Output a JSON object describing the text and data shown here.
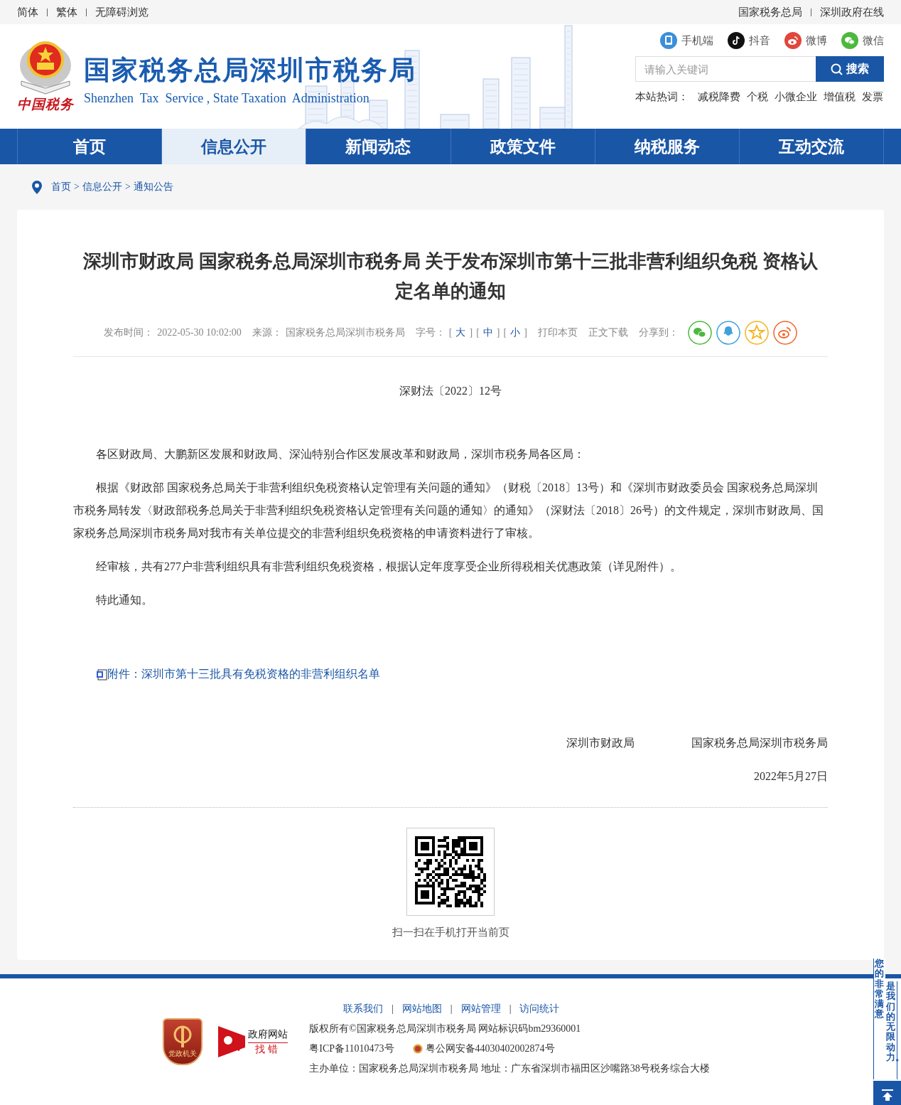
{
  "top_bar": {
    "left_links": [
      "简体",
      "繁体",
      "无障碍浏览"
    ],
    "right_links": [
      "国家税务总局",
      "深圳政府在线"
    ]
  },
  "header": {
    "emblem_caption": "中国税务",
    "site_name": "国家税务总局深圳市税务局",
    "site_name_en": "Shenzhen  Tax  Service , State Taxation  Administration",
    "social": [
      {
        "kind": "mobile",
        "label": "手机端"
      },
      {
        "kind": "douyin",
        "label": "抖音"
      },
      {
        "kind": "weibo",
        "label": "微博"
      },
      {
        "kind": "wechat",
        "label": "微信"
      }
    ],
    "search": {
      "placeholder": "请输入关键词",
      "button": "搜索"
    },
    "hot_words": {
      "label": "本站热词：",
      "words": [
        "减税降费",
        "个税",
        "小微企业",
        "增值税",
        "发票"
      ]
    }
  },
  "nav": [
    {
      "label": "首页",
      "selected": false
    },
    {
      "label": "信息公开",
      "selected": true
    },
    {
      "label": "新闻动态",
      "selected": false
    },
    {
      "label": "政策文件",
      "selected": false
    },
    {
      "label": "纳税服务",
      "selected": false
    },
    {
      "label": "互动交流",
      "selected": false
    }
  ],
  "breadcrumb": {
    "items": [
      "首页",
      "信息公开",
      "通知公告"
    ],
    "separators": [
      ">",
      ">"
    ]
  },
  "article": {
    "title": "深圳市财政局 国家税务总局深圳市税务局 关于发布深圳市第十三批非营利组织免税 资格认定名单的通知",
    "meta": {
      "published_label": "发布时间：",
      "published": "2022-05-30 10:02:00",
      "source_label": "来源：",
      "source": "国家税务总局深圳市税务局",
      "font_size_label": "字号：",
      "font_sizes": [
        {
          "open": "[",
          "label": "大",
          "close": "]"
        },
        {
          "open": "[",
          "label": "中",
          "close": "]"
        },
        {
          "open": "[",
          "label": "小",
          "close": "]"
        }
      ],
      "print": "打印本页",
      "download": "正文下载",
      "share_label": "分享到："
    },
    "share": [
      {
        "kind": "wechat"
      },
      {
        "kind": "qq"
      },
      {
        "kind": "qzone"
      },
      {
        "kind": "weibo"
      }
    ],
    "doc_number": "深财法〔2022〕12号",
    "paragraphs": [
      "各区财政局、大鹏新区发展和财政局、深汕特别合作区发展改革和财政局，深圳市税务局各区局：",
      "根据《财政部 国家税务总局关于非营利组织免税资格认定管理有关问题的通知》（财税〔2018〕13号）和《深圳市财政委员会 国家税务总局深圳市税务局转发〈财政部税务总局关于非营利组织免税资格认定管理有关问题的通知〉的通知》（深财法〔2018〕26号）的文件规定，深圳市财政局、国家税务总局深圳市税务局对我市有关单位提交的非营利组织免税资格的申请资料进行了审核。",
      "经审核，共有277户非营利组织具有非营利组织免税资格，根据认定年度享受企业所得税相关优惠政策（详见附件）。",
      "特此通知。"
    ],
    "attachment": "附件：深圳市第十三批具有免税资格的非营利组织名单",
    "signatures": [
      "深圳市财政局",
      "国家税务总局深圳市税务局"
    ],
    "date": "2022年5月27日",
    "qr_caption": "扫一扫在手机打开当前页"
  },
  "footer": {
    "links": [
      "联系我们",
      "网站地图",
      "网站管理",
      "访问统计"
    ],
    "link_separators": [
      "|",
      "|",
      "|"
    ],
    "party_badge": "党政机关",
    "gov_badge": [
      "政府网站",
      "找错"
    ],
    "copyright": "版权所有©国家税务总局深圳市税务局 网站标识码bm29360001",
    "icp": "粤ICP备11010473号",
    "police": "粤公网安备44030402002874号",
    "host": "主办单位：国家税务总局深圳市税务局 地址：广东省深圳市福田区沙嘴路38号税务综合大楼"
  },
  "side_widget": {
    "lines": [
      "您的非常满意",
      "是我们的无限动力。"
    ]
  }
}
